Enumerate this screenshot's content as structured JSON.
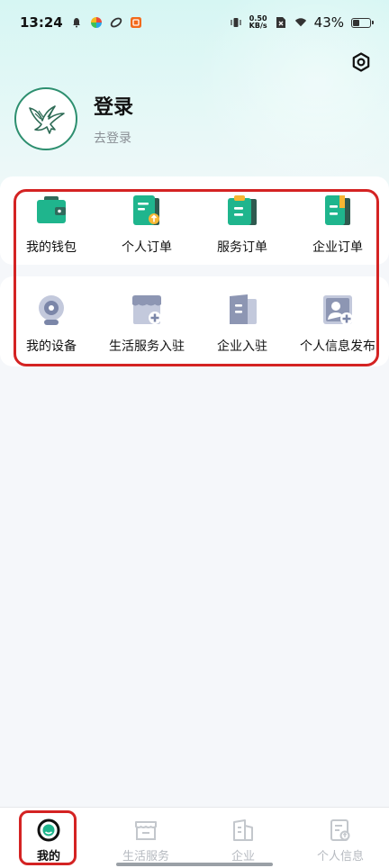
{
  "status_bar": {
    "time": "13:24",
    "net_speed_value": "0.50",
    "net_speed_unit": "KB/s",
    "battery_percent": "43%",
    "battery_level": 0.43
  },
  "profile": {
    "title": "登录",
    "subtitle": "去登录"
  },
  "menu_row_1": [
    {
      "label": "我的钱包",
      "icon": "wallet-icon"
    },
    {
      "label": "个人订单",
      "icon": "personal-order-icon"
    },
    {
      "label": "服务订单",
      "icon": "service-order-icon"
    },
    {
      "label": "企业订单",
      "icon": "enterprise-order-icon"
    }
  ],
  "menu_row_2": [
    {
      "label": "我的设备",
      "icon": "device-icon"
    },
    {
      "label": "生活服务入驻",
      "icon": "store-add-icon"
    },
    {
      "label": "企业入驻",
      "icon": "enterprise-building-icon"
    },
    {
      "label": "个人信息发布",
      "icon": "person-add-icon"
    }
  ],
  "bottom_nav": [
    {
      "label": "我的",
      "icon": "my-profile-icon",
      "active": true
    },
    {
      "label": "生活服务",
      "icon": "store-icon",
      "active": false
    },
    {
      "label": "企业",
      "icon": "building-icon",
      "active": false
    },
    {
      "label": "个人信息",
      "icon": "document-icon",
      "active": false
    }
  ],
  "colors": {
    "accent_green": "#1fb58d",
    "dark_green": "#2d8f6f",
    "highlight_red": "#d42323",
    "muted_blue_grey": "#8d96b3"
  }
}
